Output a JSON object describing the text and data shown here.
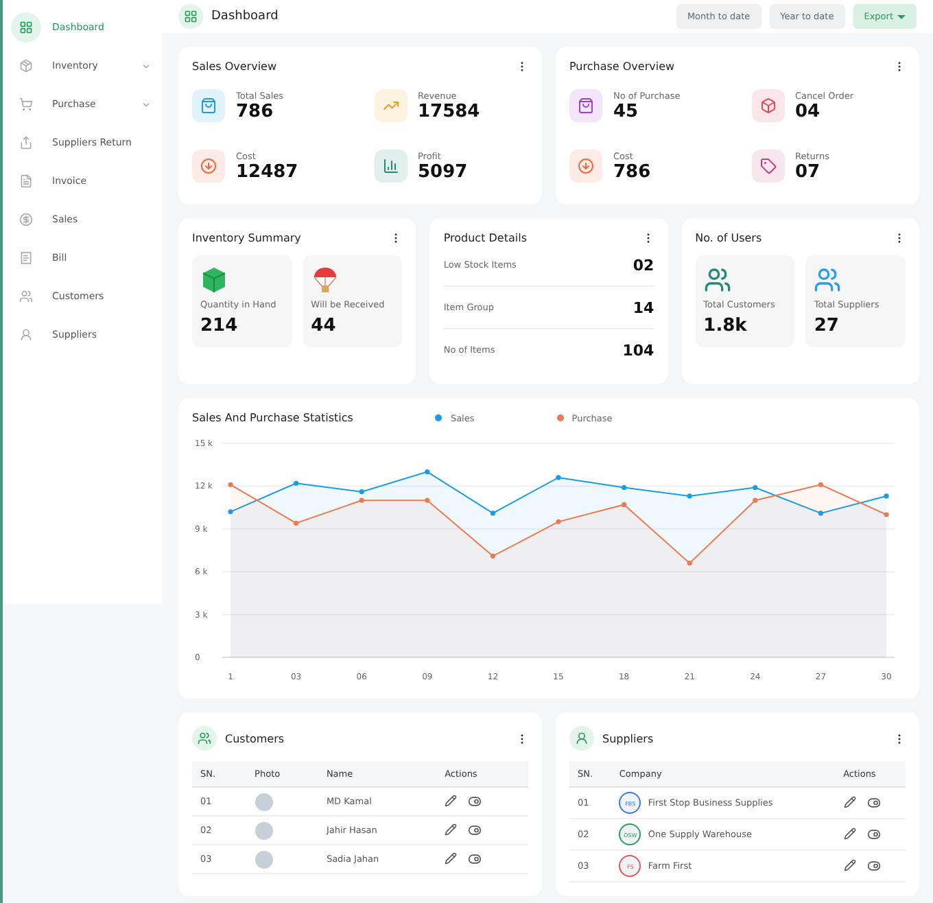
{
  "sidebar": {
    "items": [
      {
        "label": "Dashboard",
        "selected": true,
        "has_submenu": false
      },
      {
        "label": "Inventory",
        "selected": false,
        "has_submenu": true
      },
      {
        "label": "Purchase",
        "selected": false,
        "has_submenu": true
      },
      {
        "label": "Suppliers Return",
        "selected": false,
        "has_submenu": false
      },
      {
        "label": "Invoice",
        "selected": false,
        "has_submenu": false
      },
      {
        "label": "Sales",
        "selected": false,
        "has_submenu": false
      },
      {
        "label": "Bill",
        "selected": false,
        "has_submenu": false
      },
      {
        "label": "Customers",
        "selected": false,
        "has_submenu": false
      },
      {
        "label": "Suppliers",
        "selected": false,
        "has_submenu": false
      }
    ]
  },
  "header": {
    "title": "Dashboard",
    "buttons": [
      {
        "label": "Month to date",
        "kind": "plain"
      },
      {
        "label": "Year to date",
        "kind": "plain"
      },
      {
        "label": "Export",
        "kind": "dropdown"
      }
    ]
  },
  "overviews": [
    {
      "title": "Sales Overview",
      "stats": [
        {
          "label": "Total Sales",
          "value": "786",
          "color": "#1e9be0"
        },
        {
          "label": "Revenue",
          "value": "17584",
          "color": "#e9a21c"
        },
        {
          "label": "Cost",
          "value": "12487",
          "color": "#ee6a45"
        },
        {
          "label": "Profit",
          "value": "5097",
          "color": "#1f8a7a"
        }
      ]
    },
    {
      "title": "Purchase Overview",
      "stats": [
        {
          "label": "No of Purchase",
          "value": "45",
          "color": "#a43fd6"
        },
        {
          "label": "Cancel Order",
          "value": "04",
          "color": "#e04a5a"
        },
        {
          "label": "Cost",
          "value": "786",
          "color": "#ee6a45"
        },
        {
          "label": "Returns",
          "value": "07",
          "color": "#c2407a"
        }
      ]
    }
  ],
  "inventory_summary": {
    "title": "Inventory Summary",
    "tiles": [
      {
        "label": "Quantity in Hand",
        "value": "214"
      },
      {
        "label": "Will be Received",
        "value": "44"
      }
    ]
  },
  "product_details": {
    "title": "Product Details",
    "rows": [
      {
        "label": "Low Stock Items",
        "value": "02"
      },
      {
        "label": "Item Group",
        "value": "14"
      },
      {
        "label": "No of Items",
        "value": "104"
      }
    ]
  },
  "users": {
    "title": "No. of Users",
    "tiles": [
      {
        "label": "Total Customers",
        "value": "1.8k",
        "color": "#1f8a7a"
      },
      {
        "label": "Total Suppliers",
        "value": "27",
        "color": "#2a9ee6"
      }
    ]
  },
  "statistics": {
    "title": "Sales And Purchase Statistics",
    "chart_data": {
      "type": "area",
      "grid": true,
      "categories": [
        "1",
        "03",
        "06",
        "09",
        "12",
        "15",
        "18",
        "21",
        "24",
        "27",
        "30"
      ],
      "series": [
        {
          "name": "Sales",
          "color": "#1a9be6",
          "values": [
            10200,
            12200,
            11600,
            13000,
            10100,
            12600,
            11900,
            11300,
            11900,
            10100,
            11300
          ]
        },
        {
          "name": "Purchase",
          "color": "#ec7b52",
          "values": [
            12100,
            9400,
            11000,
            11000,
            7100,
            9500,
            10700,
            6600,
            11000,
            12100,
            10000
          ]
        }
      ],
      "ylim": [
        0,
        15000
      ],
      "yticks": [
        {
          "value": 0,
          "label": "0"
        },
        {
          "value": 3000,
          "label": "3 k"
        },
        {
          "value": 6000,
          "label": "6 k"
        },
        {
          "value": 9000,
          "label": "9 k"
        },
        {
          "value": 12000,
          "label": "12 k"
        },
        {
          "value": 15000,
          "label": "15 k"
        }
      ]
    }
  },
  "customers": {
    "title": "Customers",
    "columns": [
      "SN.",
      "Photo",
      "Name",
      "Actions"
    ],
    "rows": [
      {
        "sn": "01",
        "name": "MD Kamal",
        "active": true
      },
      {
        "sn": "02",
        "name": "Jahir Hasan",
        "active": true
      },
      {
        "sn": "03",
        "name": "Sadia Jahan",
        "active": true
      }
    ]
  },
  "suppliers": {
    "title": "Suppliers",
    "columns": [
      "SN.",
      "Company",
      "Actions"
    ],
    "rows": [
      {
        "sn": "01",
        "initials": "FBS",
        "company": "First Stop Business Supplies",
        "color": "#3b7be0",
        "active": true
      },
      {
        "sn": "02",
        "initials": "OSW",
        "company": "One Supply Warehouse",
        "color": "#2e9c5a",
        "active": true
      },
      {
        "sn": "03",
        "initials": "FS",
        "company": "Farm First",
        "color": "#e05a5a",
        "active": true
      }
    ]
  }
}
